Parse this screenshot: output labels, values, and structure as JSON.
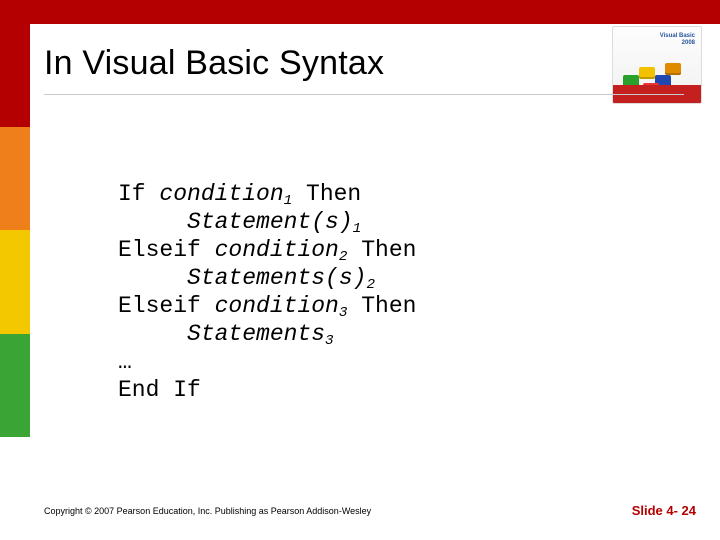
{
  "title": "In Visual Basic Syntax",
  "cover": {
    "title_line1": "Visual Basic",
    "title_line2": "2008"
  },
  "code": {
    "l1": {
      "kw1": "If ",
      "it": "condition",
      "sub": "1",
      "kw2": " Then"
    },
    "l2": {
      "pad": "     ",
      "it": "Statement(s)",
      "sub": "1"
    },
    "l3": {
      "kw1": "Elseif ",
      "it": "condition",
      "sub": "2",
      "kw2": " Then"
    },
    "l4": {
      "pad": "     ",
      "it": "Statements(s)",
      "sub": "2"
    },
    "l5": {
      "kw1": "Elseif ",
      "it": "condition",
      "sub": "3",
      "kw2": " Then"
    },
    "l6": {
      "pad": "     ",
      "it": "Statements",
      "sub": "3"
    },
    "l7": "…",
    "l8": "End If"
  },
  "footer": {
    "copyright": "Copyright © 2007 Pearson Education, Inc. Publishing as Pearson Addison-Wesley",
    "slide": "Slide 4- 24"
  }
}
